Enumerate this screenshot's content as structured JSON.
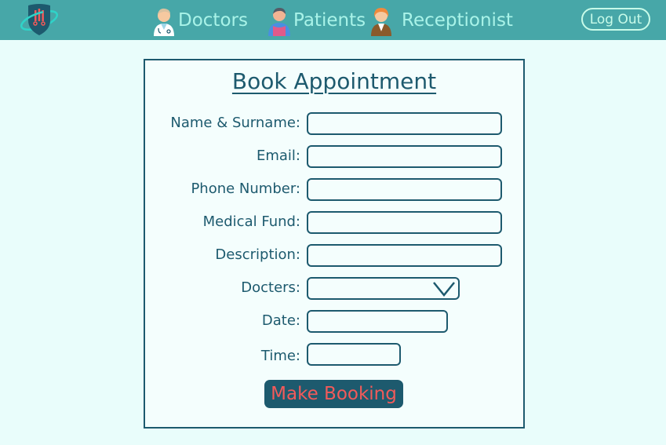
{
  "nav": {
    "items": [
      {
        "label": "Doctors",
        "icon": "doctor-avatar-icon"
      },
      {
        "label": "Patients",
        "icon": "patient-avatar-icon"
      },
      {
        "label": "Receptionist",
        "icon": "receptionist-avatar-icon"
      }
    ],
    "logout_label": "Log Out",
    "logo_icon": "hospital-shield-logo"
  },
  "form": {
    "title": "Book Appointment",
    "fields": {
      "name": {
        "label": "Name & Surname:",
        "value": ""
      },
      "email": {
        "label": "Email:",
        "value": ""
      },
      "phone": {
        "label": "Phone Number:",
        "value": ""
      },
      "fund": {
        "label": "Medical Fund:",
        "value": ""
      },
      "description": {
        "label": "Description:",
        "value": ""
      },
      "doctors": {
        "label": "Docters:",
        "selected": ""
      },
      "date": {
        "label": "Date:",
        "value": ""
      },
      "time": {
        "label": "Time:",
        "value": ""
      }
    },
    "submit_label": "Make Booking"
  },
  "colors": {
    "navbar": "#47a7a8",
    "nav_text": "#a9f3e8",
    "page_bg": "#e9fdfb",
    "primary": "#1d5a6e",
    "button_text": "#f25a5a"
  }
}
